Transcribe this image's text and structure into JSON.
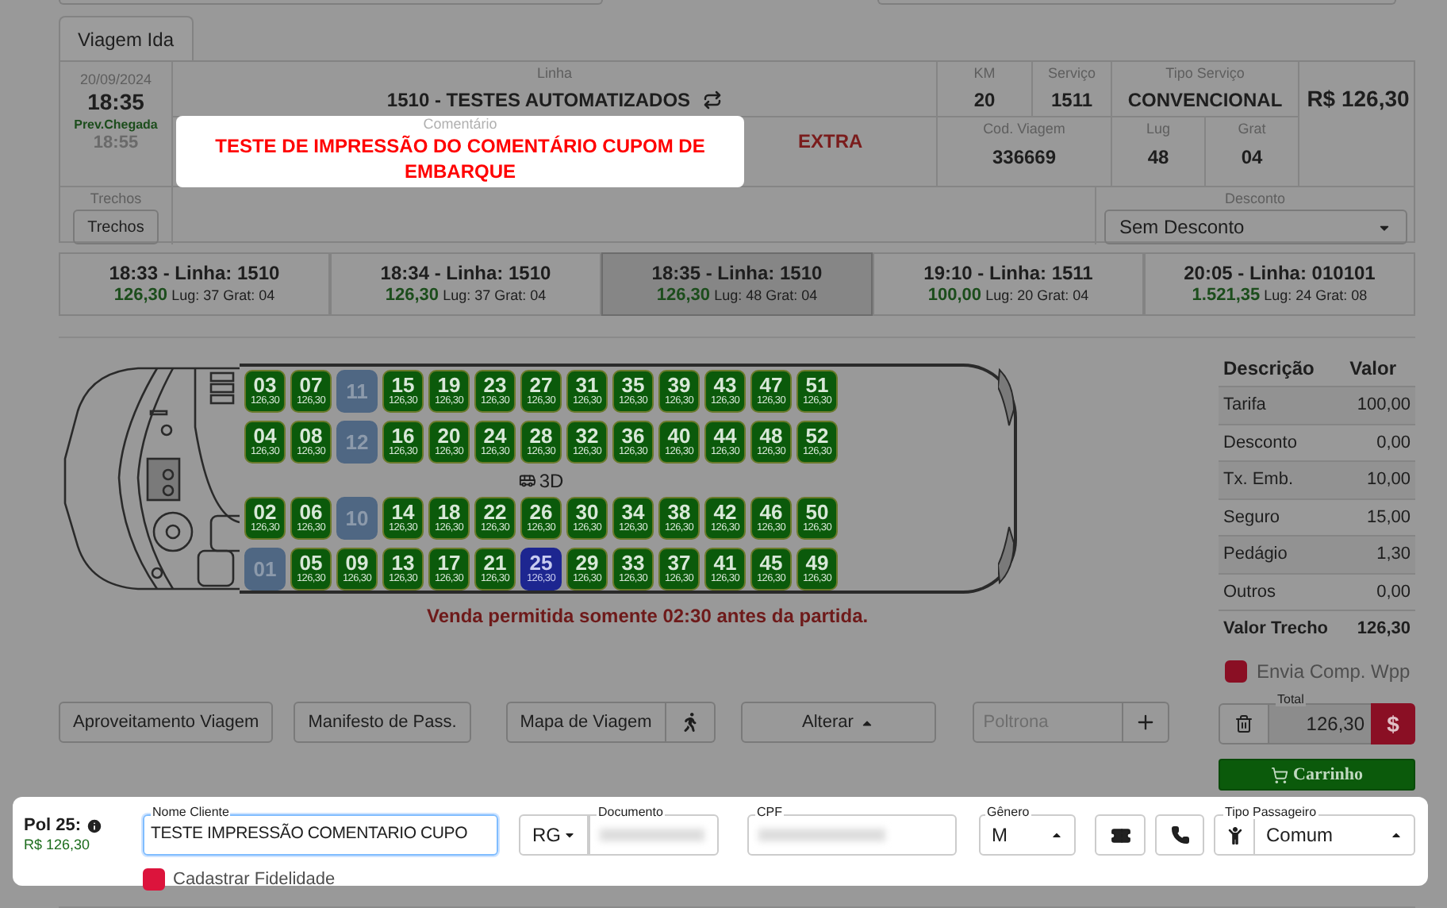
{
  "tabs": [
    {
      "label": "Viagem Ida",
      "selected": true
    }
  ],
  "trip": {
    "date": "20/09/2024",
    "departure": "18:35",
    "arrival_label": "Prev.Chegada",
    "arrival": "18:55",
    "linha_label": "Linha",
    "linha": "1510 - TESTES AUTOMATIZADOS",
    "km_label": "KM",
    "km": "20",
    "servico_label": "Serviço",
    "servico": "1511",
    "tipo_label": "Tipo Serviço",
    "tipo": "CONVENCIONAL",
    "price": "R$ 126,30",
    "comment_label": "Comentário",
    "comment": "TESTE DE IMPRESSÃO DO COMENTÁRIO CUPOM DE EMBARQUE",
    "extra": "EXTRA",
    "cod_label": "Cod. Viagem",
    "cod": "336669",
    "lug_label": "Lug",
    "lug": "48",
    "grat_label": "Grat",
    "grat": "04",
    "trechos_label": "Trechos",
    "trechos_button": "Trechos",
    "desconto_label": "Desconto",
    "desconto": "Sem Desconto"
  },
  "schedules": [
    {
      "title": "18:33 - Linha: 1510",
      "price": "126,30",
      "details": "Lug: 37 Grat: 04",
      "selected": false
    },
    {
      "title": "18:34 - Linha: 1510",
      "price": "126,30",
      "details": "Lug: 37 Grat: 04",
      "selected": false
    },
    {
      "title": "18:35 - Linha: 1510",
      "price": "126,30",
      "details": "Lug: 48 Grat: 04",
      "selected": true
    },
    {
      "title": "19:10 - Linha: 1511",
      "price": "100,00",
      "details": "Lug: 20 Grat: 04",
      "selected": false
    },
    {
      "title": "20:05 - Linha: 010101",
      "price": "1.521,35",
      "details": "Lug: 24 Grat: 08",
      "selected": false
    }
  ],
  "seat_map": {
    "deck_label": "3D",
    "notice": "Venda permitida somente 02:30 antes da partida.",
    "rows": [
      [
        {
          "number": "03",
          "price": "126,30",
          "kind": "available"
        },
        {
          "number": "07",
          "price": "126,30",
          "kind": "available"
        },
        {
          "number": "11",
          "kind": "blocked"
        },
        {
          "number": "15",
          "price": "126,30",
          "kind": "available"
        },
        {
          "number": "19",
          "price": "126,30",
          "kind": "available"
        },
        {
          "number": "23",
          "price": "126,30",
          "kind": "available"
        },
        {
          "number": "27",
          "price": "126,30",
          "kind": "available"
        },
        {
          "number": "31",
          "price": "126,30",
          "kind": "available"
        },
        {
          "number": "35",
          "price": "126,30",
          "kind": "available"
        },
        {
          "number": "39",
          "price": "126,30",
          "kind": "available"
        },
        {
          "number": "43",
          "price": "126,30",
          "kind": "available"
        },
        {
          "number": "47",
          "price": "126,30",
          "kind": "available"
        },
        {
          "number": "51",
          "price": "126,30",
          "kind": "available"
        }
      ],
      [
        {
          "number": "04",
          "price": "126,30",
          "kind": "available"
        },
        {
          "number": "08",
          "price": "126,30",
          "kind": "available"
        },
        {
          "number": "12",
          "kind": "blocked"
        },
        {
          "number": "16",
          "price": "126,30",
          "kind": "available"
        },
        {
          "number": "20",
          "price": "126,30",
          "kind": "available"
        },
        {
          "number": "24",
          "price": "126,30",
          "kind": "available"
        },
        {
          "number": "28",
          "price": "126,30",
          "kind": "available"
        },
        {
          "number": "32",
          "price": "126,30",
          "kind": "available"
        },
        {
          "number": "36",
          "price": "126,30",
          "kind": "available"
        },
        {
          "number": "40",
          "price": "126,30",
          "kind": "available"
        },
        {
          "number": "44",
          "price": "126,30",
          "kind": "available"
        },
        {
          "number": "48",
          "price": "126,30",
          "kind": "available"
        },
        {
          "number": "52",
          "price": "126,30",
          "kind": "available"
        }
      ],
      [
        {
          "number": "02",
          "price": "126,30",
          "kind": "available"
        },
        {
          "number": "06",
          "price": "126,30",
          "kind": "available"
        },
        {
          "number": "10",
          "kind": "blocked"
        },
        {
          "number": "14",
          "price": "126,30",
          "kind": "available"
        },
        {
          "number": "18",
          "price": "126,30",
          "kind": "available"
        },
        {
          "number": "22",
          "price": "126,30",
          "kind": "available"
        },
        {
          "number": "26",
          "price": "126,30",
          "kind": "available"
        },
        {
          "number": "30",
          "price": "126,30",
          "kind": "available"
        },
        {
          "number": "34",
          "price": "126,30",
          "kind": "available"
        },
        {
          "number": "38",
          "price": "126,30",
          "kind": "available"
        },
        {
          "number": "42",
          "price": "126,30",
          "kind": "available"
        },
        {
          "number": "46",
          "price": "126,30",
          "kind": "available"
        },
        {
          "number": "50",
          "price": "126,30",
          "kind": "available"
        }
      ],
      [
        {
          "number": "01",
          "kind": "blocked"
        },
        {
          "number": "05",
          "price": "126,30",
          "kind": "available"
        },
        {
          "number": "09",
          "price": "126,30",
          "kind": "available"
        },
        {
          "number": "13",
          "price": "126,30",
          "kind": "available"
        },
        {
          "number": "17",
          "price": "126,30",
          "kind": "available"
        },
        {
          "number": "21",
          "price": "126,30",
          "kind": "available"
        },
        {
          "number": "25",
          "price": "126,30",
          "kind": "selected"
        },
        {
          "number": "29",
          "price": "126,30",
          "kind": "available"
        },
        {
          "number": "33",
          "price": "126,30",
          "kind": "available"
        },
        {
          "number": "37",
          "price": "126,30",
          "kind": "available"
        },
        {
          "number": "41",
          "price": "126,30",
          "kind": "available"
        },
        {
          "number": "45",
          "price": "126,30",
          "kind": "available"
        },
        {
          "number": "49",
          "price": "126,30",
          "kind": "available"
        }
      ]
    ]
  },
  "price_table": {
    "columns": [
      "Descrição",
      "Valor"
    ],
    "rows": [
      {
        "label": "Tarifa",
        "value": "100,00"
      },
      {
        "label": "Desconto",
        "value": "0,00"
      },
      {
        "label": "Tx. Emb.",
        "value": "10,00"
      },
      {
        "label": "Seguro",
        "value": "15,00"
      },
      {
        "label": "Pedágio",
        "value": "1,30"
      },
      {
        "label": "Outros",
        "value": "0,00"
      }
    ],
    "total": {
      "label": "Valor Trecho",
      "value": "126,30"
    }
  },
  "whatsapp_receipt": {
    "label": "Envia Comp. Wpp",
    "checked": true
  },
  "actions": {
    "buttons": [
      "Aproveitamento Viagem",
      "Manifesto de Pass.",
      "Mapa de Viagem"
    ],
    "alterar": "Alterar",
    "seat_placeholder": "Poltrona"
  },
  "total": {
    "label": "Total",
    "value": "126,30",
    "pay_symbol": "$",
    "cart": "Carrinho"
  },
  "passenger": {
    "seat": "Pol 25:",
    "price": "R$ 126,30",
    "name_label": "Nome Cliente",
    "name": "TESTE IMPRESSÃO COMENTARIO CUPO",
    "doc_type": "RG",
    "doc_label": "Documento",
    "cpf_label": "CPF",
    "gender_label": "Gênero",
    "gender": "M",
    "type_label": "Tipo Passageiro",
    "type": "Comum",
    "loyalty": {
      "label": "Cadastrar Fidelidade",
      "checked": true
    }
  }
}
